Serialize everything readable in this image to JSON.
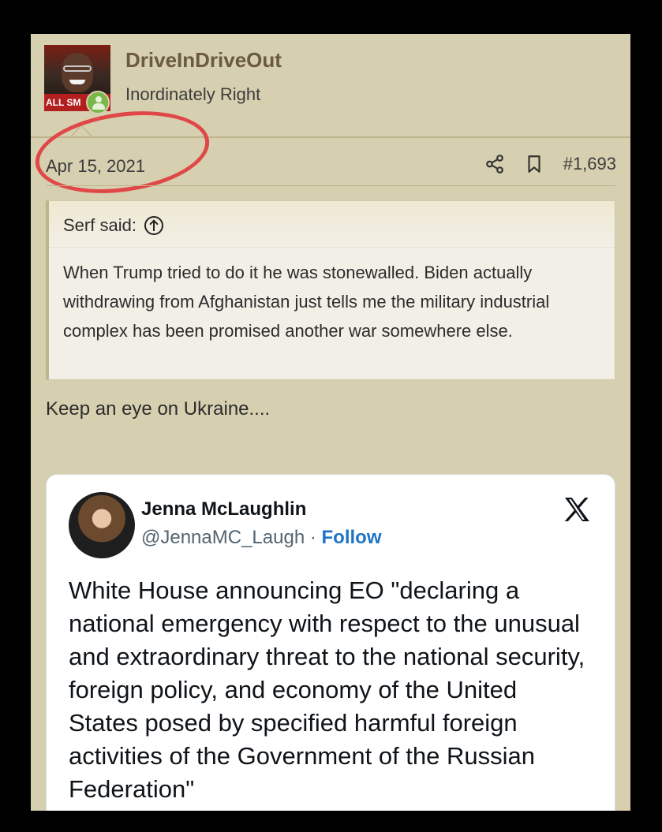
{
  "post": {
    "username": "DriveInDriveOut",
    "user_title": "Inordinately Right",
    "avatar_banner": "ALL SM",
    "date": "Apr 15, 2021",
    "post_number": "#1,693"
  },
  "quote": {
    "author_line": "Serf said:",
    "text": "When Trump tried to do it he was stonewalled. Biden actually withdrawing from Afghanistan just tells me the military industrial complex has been promised another war somewhere else."
  },
  "reply_text": "Keep an eye on Ukraine....",
  "tweet": {
    "name": "Jenna McLaughlin",
    "handle": "@JennaMC_Laugh",
    "separator": " · ",
    "follow_label": "Follow",
    "text": "White House announcing EO \"declaring a national emergency with respect to the unusual and extraordinary threat to the national security, foreign policy, and economy of the United States posed by specified harmful foreign activities of the Government of the Russian Federation\""
  },
  "colors": {
    "panel_bg": "#d6cfb0",
    "annotation_red": "#e04848",
    "follow_blue": "#1d74c9"
  },
  "icons": [
    "share-icon",
    "bookmark-icon",
    "expand-quote-icon",
    "x-logo-icon",
    "online-status-icon"
  ]
}
